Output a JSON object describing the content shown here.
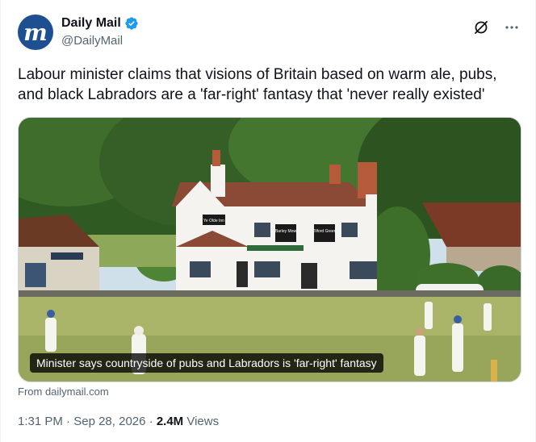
{
  "author": {
    "display_name": "Daily Mail",
    "handle": "@DailyMail",
    "avatar_letter": "m",
    "avatar_color": "#1d4f91",
    "verified_color": "#1d9bf0"
  },
  "tweet": {
    "text": "Labour minister claims that visions of Britain based on warm ale, pubs, and black Labradors are a 'far-right' fantasy that 'never really existed'"
  },
  "media": {
    "caption": "Minister says countryside of pubs and Labradors is 'far-right' fantasy",
    "pub_sign": "Ye Olde Inn",
    "sign_left": "Barley Mow",
    "sign_right": "Tilford Green"
  },
  "source": {
    "label": "From dailymail.com"
  },
  "meta": {
    "time": "1:31 PM",
    "separator": "·",
    "date": "Sep 28, 2026",
    "views_count": "2.4M",
    "views_label": "Views"
  },
  "icons": {
    "grok": "grok-icon",
    "more": "more-icon",
    "verified": "verified-badge-icon"
  }
}
